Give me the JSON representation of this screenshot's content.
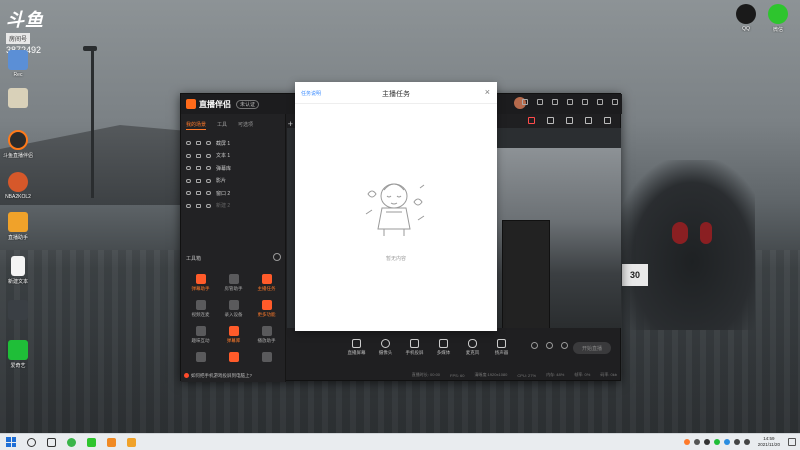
{
  "desktop": {
    "douyu": {
      "logo": "斗鱼",
      "tag": "房间号",
      "room": "3872492"
    },
    "icons": [
      {
        "id": "d1",
        "label": "Rec",
        "color": "#5b8fd6"
      },
      {
        "id": "d2",
        "label": "",
        "color": "#d9d1b9"
      },
      {
        "id": "d3",
        "label": "斗鱼直播伴侣",
        "color": "#2b2b2b"
      },
      {
        "id": "d4",
        "label": "NBA2KOL2",
        "color": "#d6582a"
      },
      {
        "id": "d5",
        "label": "直播助手",
        "color": "#f0a22a"
      },
      {
        "id": "d6",
        "label": "新建文本",
        "color": "#f4f4f4"
      },
      {
        "id": "d7",
        "label": "",
        "color": "#3a3f44"
      },
      {
        "id": "d8",
        "label": "爱奇艺",
        "color": "#1fbe38"
      }
    ],
    "right_icons": [
      {
        "id": "r1",
        "label": "QQ"
      },
      {
        "id": "r2",
        "label": "微信"
      }
    ]
  },
  "app": {
    "name": "直播伴侣",
    "badge": "未认证",
    "tabs": [
      "我的场景",
      "工具",
      "可选项"
    ],
    "scenes": [
      {
        "label": "截屏 1",
        "dim": false
      },
      {
        "label": "文本 1",
        "dim": false
      },
      {
        "label": "弹幕库",
        "dim": false
      },
      {
        "label": "影片",
        "dim": false
      },
      {
        "label": "窗口 2",
        "dim": false
      },
      {
        "label": "新建 2",
        "dim": true
      }
    ],
    "toolbox_title": "工具箱",
    "tools": [
      {
        "label": "弹幕助手",
        "hot": true
      },
      {
        "label": "房管助手",
        "hot": false
      },
      {
        "label": "主播任务",
        "hot": true
      },
      {
        "label": "视频连麦",
        "hot": false
      },
      {
        "label": "录入设备",
        "hot": false
      },
      {
        "label": "更多功能",
        "hot": true
      },
      {
        "label": "趣味互动",
        "hot": false
      },
      {
        "label": "弹幕库",
        "hot": true
      },
      {
        "label": "播放助手",
        "hot": false
      },
      {
        "label": "",
        "hot": false
      },
      {
        "label": "",
        "hot": true
      },
      {
        "label": "",
        "hot": false
      }
    ],
    "notice": "如何把手机游戏投屏到电脑上?",
    "bottom_buttons": [
      {
        "label": "直播屏幕",
        "icon": "screen-icon"
      },
      {
        "label": "摄像头",
        "icon": "camera-icon"
      },
      {
        "label": "手机投屏",
        "icon": "phone-cast-icon"
      },
      {
        "label": "多媒体",
        "icon": "media-icon"
      },
      {
        "label": "麦克风",
        "icon": "mic-icon"
      },
      {
        "label": "扬声器",
        "icon": "speaker-icon"
      }
    ],
    "go_live": "开始直播",
    "status": [
      "直播时长: 00:00",
      "FPS: 60",
      "清晰度:1920x1080",
      "CPU: 27%",
      "内存: 48%",
      "帧率: 0%",
      "码率: 0kb"
    ]
  },
  "modal": {
    "help_link": "任务说明",
    "title": "主播任务",
    "close": "×",
    "empty_text": "暂无内容"
  },
  "taskbar": {
    "time": "14:59",
    "date": "2021/11/20"
  }
}
